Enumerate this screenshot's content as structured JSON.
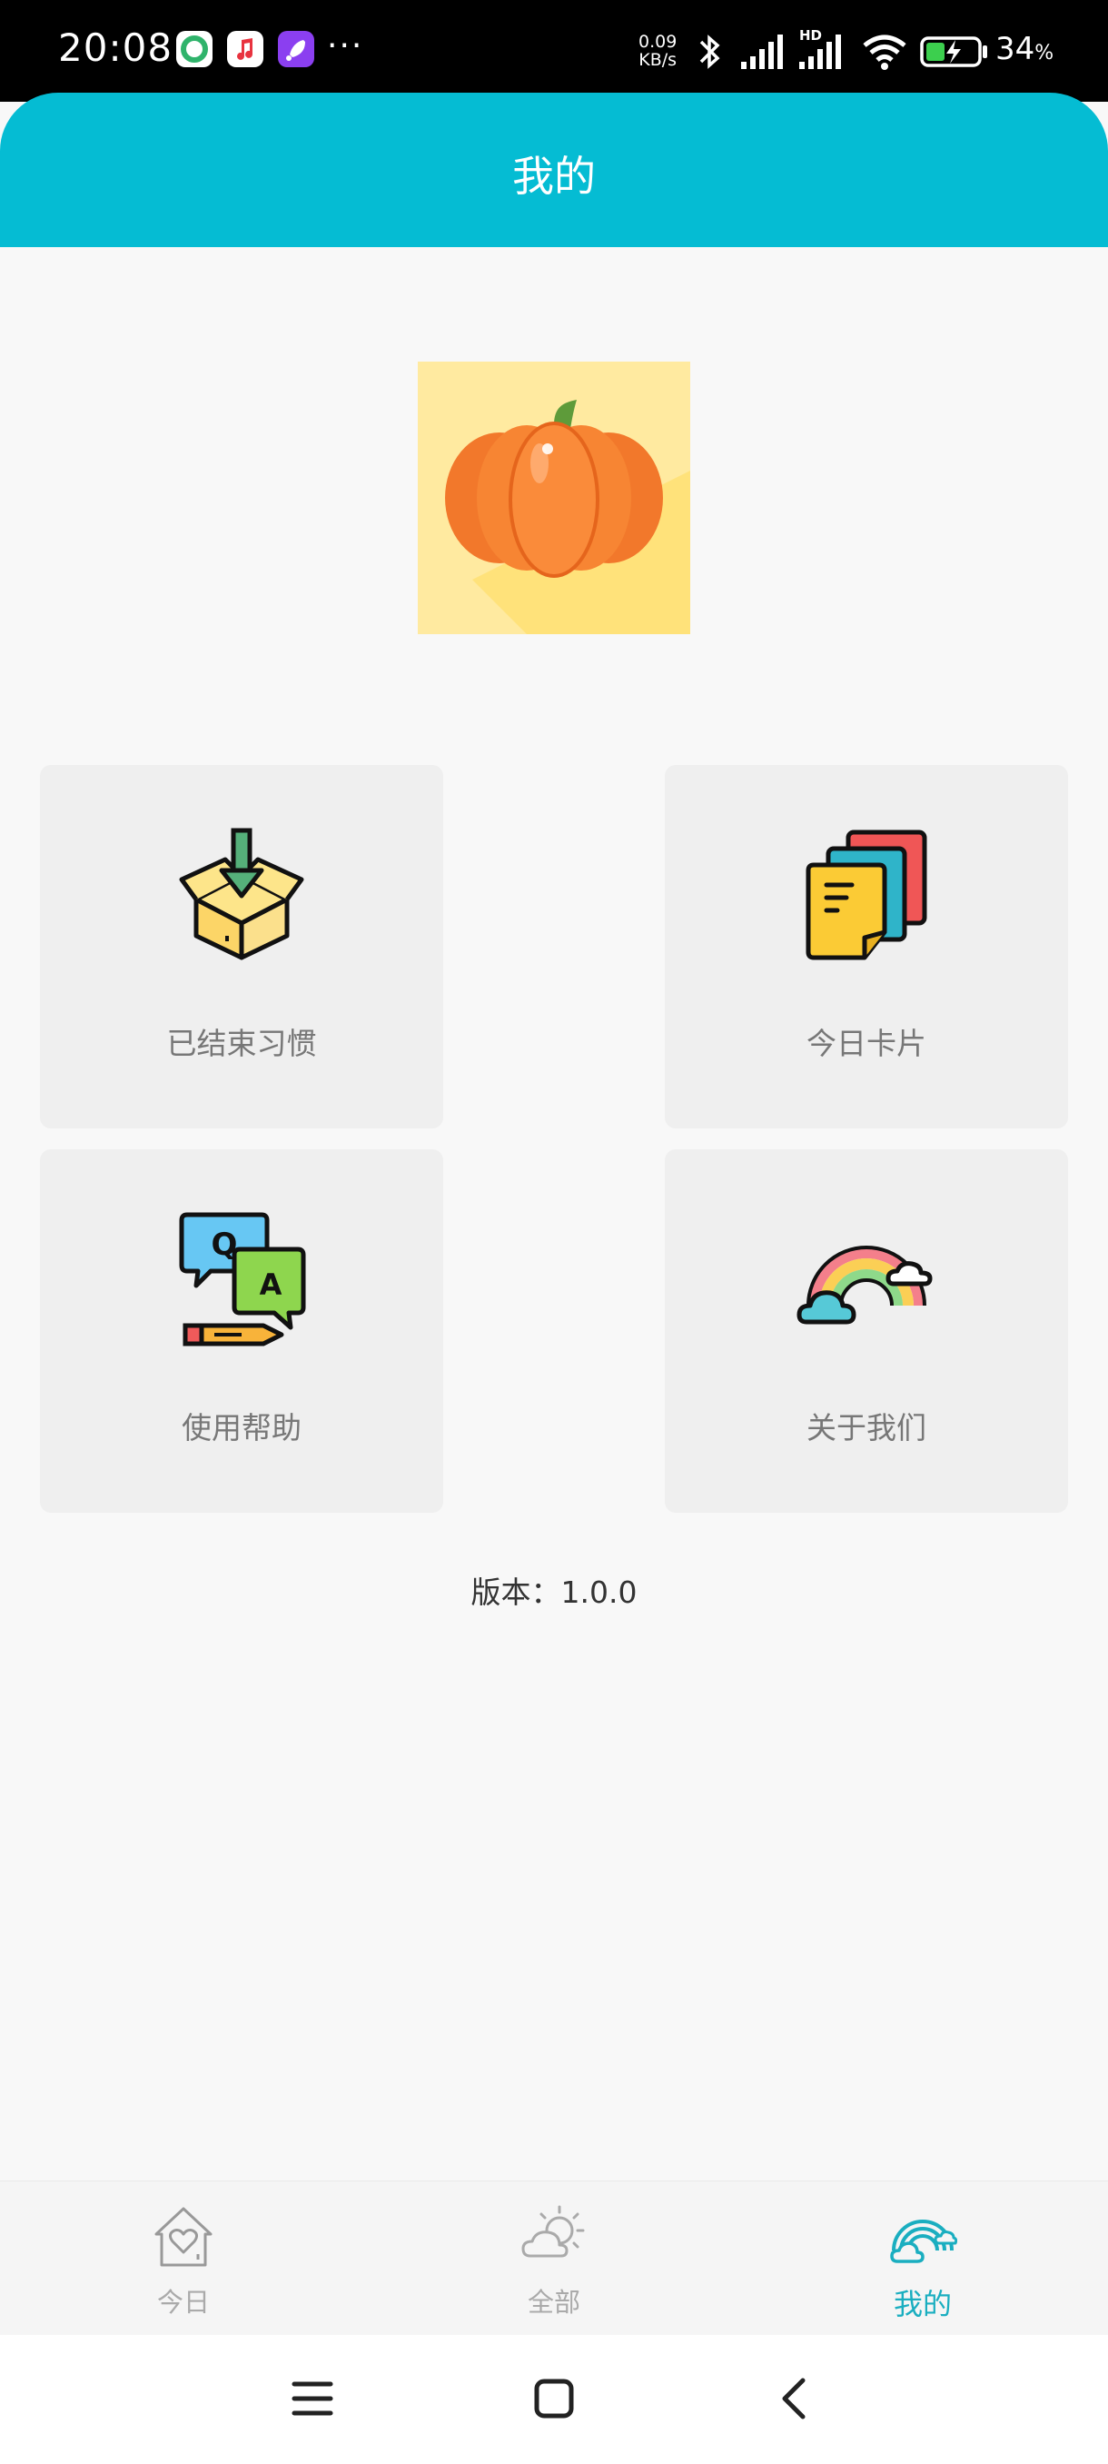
{
  "status_bar": {
    "time": "20:08",
    "dots": "···",
    "net_speed_value": "0.09",
    "net_speed_unit": "KB/s",
    "signal_badge": "HD",
    "battery_percent": "34",
    "battery_unit": "%"
  },
  "header": {
    "title": "我的"
  },
  "menu": {
    "items": [
      {
        "label": "已结束习惯",
        "icon": "box-download-icon"
      },
      {
        "label": "今日卡片",
        "icon": "cards-stack-icon"
      },
      {
        "label": "使用帮助",
        "icon": "qa-chat-icon"
      },
      {
        "label": "关于我们",
        "icon": "rainbow-icon"
      }
    ]
  },
  "version": "版本：1.0.0",
  "bottom_nav": {
    "items": [
      {
        "label": "今日",
        "icon": "house-heart-icon",
        "active": false
      },
      {
        "label": "全部",
        "icon": "sun-cloud-icon",
        "active": false
      },
      {
        "label": "我的",
        "icon": "rainbow-cloud-icon",
        "active": true
      }
    ]
  },
  "colors": {
    "accent": "#05bcd3",
    "active_tab": "#1aaec0",
    "card_bg": "#efefef",
    "page_bg": "#f8f8f8"
  }
}
